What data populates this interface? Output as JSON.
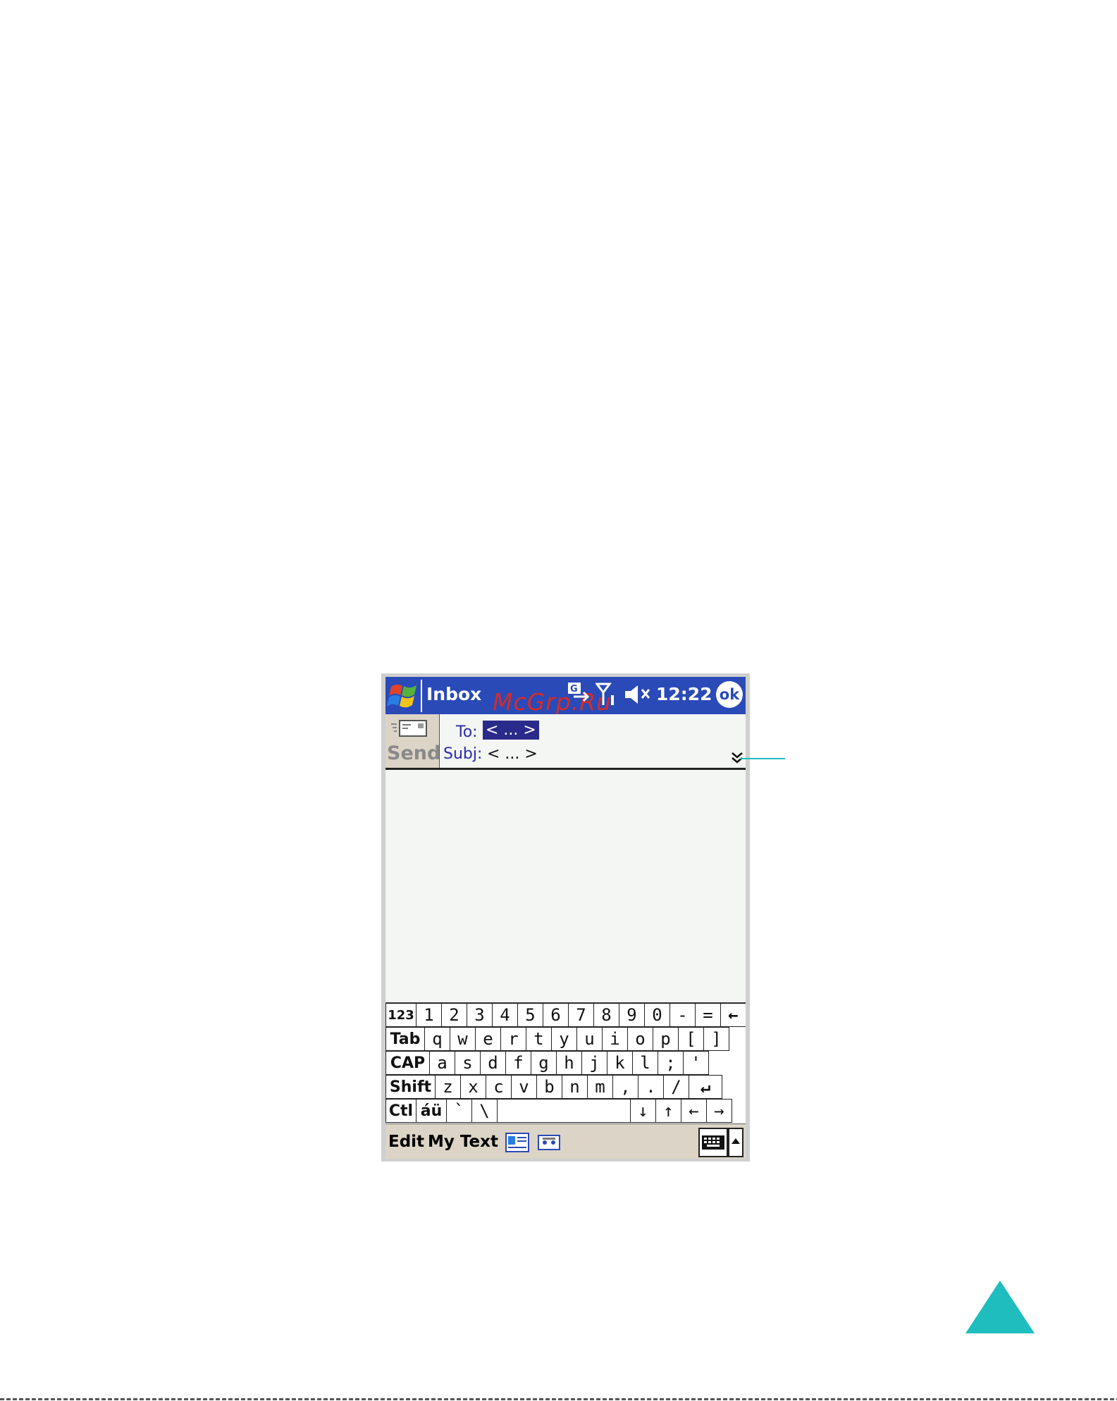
{
  "titlebar": {
    "app_title": "Inbox",
    "watermark": "McGrp.Ru",
    "time": "12:22",
    "ok_label": "ok"
  },
  "header": {
    "send_label": "Send",
    "to_label": "To:",
    "to_value": "< ... >",
    "subj_label": "Subj:",
    "subj_value": "< ... >",
    "expand_icon": "double-chevron-down-icon"
  },
  "keyboard": {
    "row1": [
      "123",
      "1",
      "2",
      "3",
      "4",
      "5",
      "6",
      "7",
      "8",
      "9",
      "0",
      "-",
      "=",
      "←"
    ],
    "row2": [
      "Tab",
      "q",
      "w",
      "e",
      "r",
      "t",
      "y",
      "u",
      "i",
      "o",
      "p",
      "[",
      "]"
    ],
    "row3": [
      "CAP",
      "a",
      "s",
      "d",
      "f",
      "g",
      "h",
      "j",
      "k",
      "l",
      ";",
      "'"
    ],
    "row4": [
      "Shift",
      "z",
      "x",
      "c",
      "v",
      "b",
      "n",
      "m",
      ",",
      ".",
      "/",
      "↵"
    ],
    "row5": [
      "Ctl",
      "áü",
      "`",
      "\\",
      "",
      "↓",
      "↑",
      "←",
      "→"
    ]
  },
  "menubar": {
    "edit_label": "Edit",
    "mytext_label": "My Text"
  },
  "colors": {
    "titlebar_bg": "#2a4ab8",
    "accent_teal": "#1fbdbd",
    "watermark_red": "#e22a1f"
  }
}
